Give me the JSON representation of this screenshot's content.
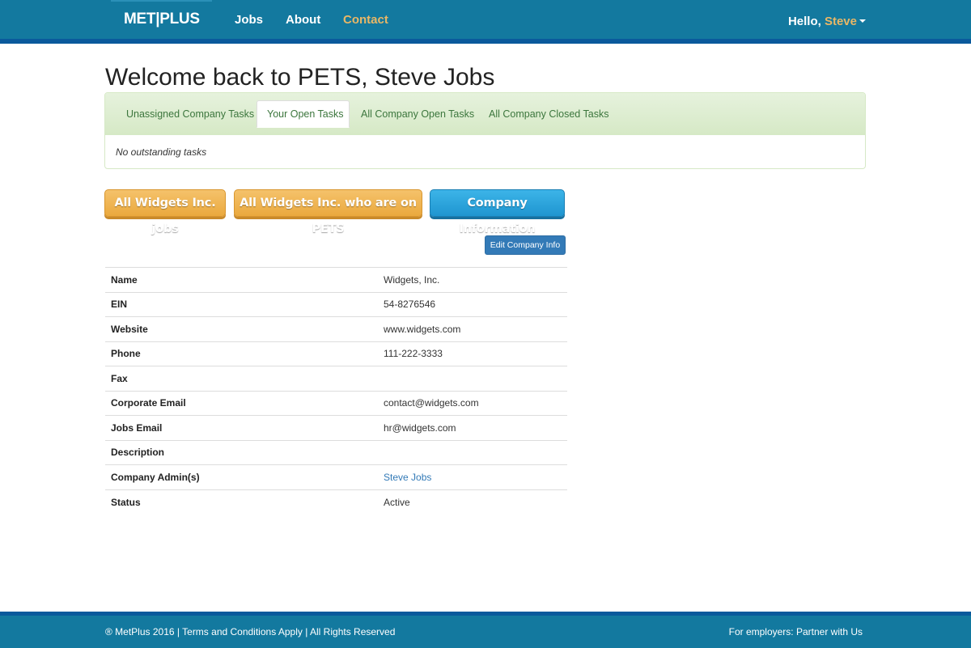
{
  "navbar": {
    "brand": "MET|PLUS",
    "links": [
      "Jobs",
      "About",
      "Contact"
    ],
    "hello_prefix": "Hello, ",
    "user_name": "Steve",
    "color": "#13799f",
    "active_color": "#e9b766"
  },
  "page": {
    "title": "Welcome back to PETS, Steve Jobs"
  },
  "tasks": {
    "tabs": [
      "Unassigned Company Tasks",
      "Your Open Tasks",
      "All Company Open Tasks",
      "All Company Closed Tasks"
    ],
    "active_tab": "Your Open Tasks",
    "empty_message": "No outstanding tasks"
  },
  "actions": {
    "jobs_button": "All Widgets Inc. jobs",
    "pets_button": "All Widgets Inc. who are on PETS",
    "info_button": "Company Information",
    "edit_button": "Edit Company Info"
  },
  "company": {
    "rows": [
      {
        "label": "Name",
        "value": "Widgets, Inc."
      },
      {
        "label": "EIN",
        "value": "54-8276546"
      },
      {
        "label": "Website",
        "value": "www.widgets.com"
      },
      {
        "label": "Phone",
        "value": "111-222-3333"
      },
      {
        "label": "Fax",
        "value": ""
      },
      {
        "label": "Corporate Email",
        "value": "contact@widgets.com"
      },
      {
        "label": "Jobs Email",
        "value": "hr@widgets.com"
      },
      {
        "label": "Description",
        "value": ""
      },
      {
        "label": "Company Admin(s)",
        "value": "Steve Jobs"
      },
      {
        "label": "Status",
        "value": "Active"
      }
    ]
  },
  "footer": {
    "copyright": "® MetPlus 2016",
    "sep": " | ",
    "terms": "Terms and Conditions Apply",
    "rights": "All Rights Reserved",
    "partner": "For employers: Partner with Us"
  }
}
